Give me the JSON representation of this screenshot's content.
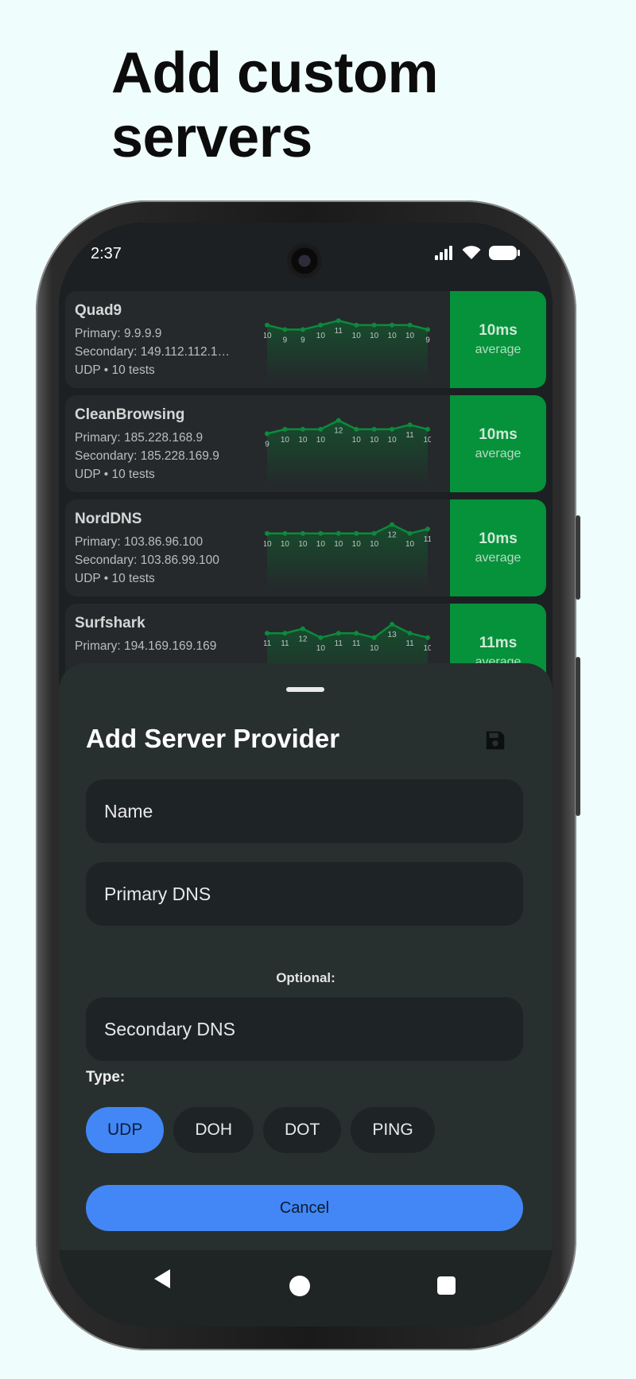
{
  "headline": "Add custom servers",
  "status_bar": {
    "time": "2:37"
  },
  "servers": [
    {
      "name": "Quad9",
      "primary": "Primary: 9.9.9.9",
      "secondary": "Secondary: 149.112.112.1…",
      "meta": "UDP • 10 tests",
      "average": "10ms",
      "average_label": "average",
      "pings": [
        10,
        9,
        9,
        10,
        11,
        10,
        10,
        10,
        10,
        9
      ]
    },
    {
      "name": "CleanBrowsing",
      "primary": "Primary: 185.228.168.9",
      "secondary": "Secondary: 185.228.169.9",
      "meta": "UDP • 10 tests",
      "average": "10ms",
      "average_label": "average",
      "pings": [
        9,
        10,
        10,
        10,
        12,
        10,
        10,
        10,
        11,
        10
      ]
    },
    {
      "name": "NordDNS",
      "primary": "Primary: 103.86.96.100",
      "secondary": "Secondary: 103.86.99.100",
      "meta": "UDP • 10 tests",
      "average": "10ms",
      "average_label": "average",
      "pings": [
        10,
        10,
        10,
        10,
        10,
        10,
        10,
        12,
        10,
        11
      ]
    },
    {
      "name": "Surfshark",
      "primary": "Primary: 194.169.169.169",
      "secondary": "",
      "meta": "",
      "average": "11ms",
      "average_label": "average",
      "pings": [
        11,
        11,
        12,
        10,
        11,
        11,
        10,
        13,
        11,
        10
      ]
    }
  ],
  "sheet": {
    "title": "Add Server Provider",
    "save_icon": "save-icon",
    "name_placeholder": "Name",
    "primary_placeholder": "Primary DNS",
    "optional_label": "Optional:",
    "secondary_placeholder": "Secondary DNS",
    "type_label": "Type:",
    "types": [
      "UDP",
      "DOH",
      "DOT",
      "PING"
    ],
    "selected_type": "UDP",
    "cancel_label": "Cancel"
  },
  "colors": {
    "background": "#effdfc",
    "accent_green": "#06913b",
    "accent_blue": "#4287f5",
    "sheet": "#27302f"
  },
  "nav": {
    "back_icon": "back-triangle-icon",
    "home_icon": "home-circle-icon",
    "recents_icon": "recents-square-icon"
  }
}
